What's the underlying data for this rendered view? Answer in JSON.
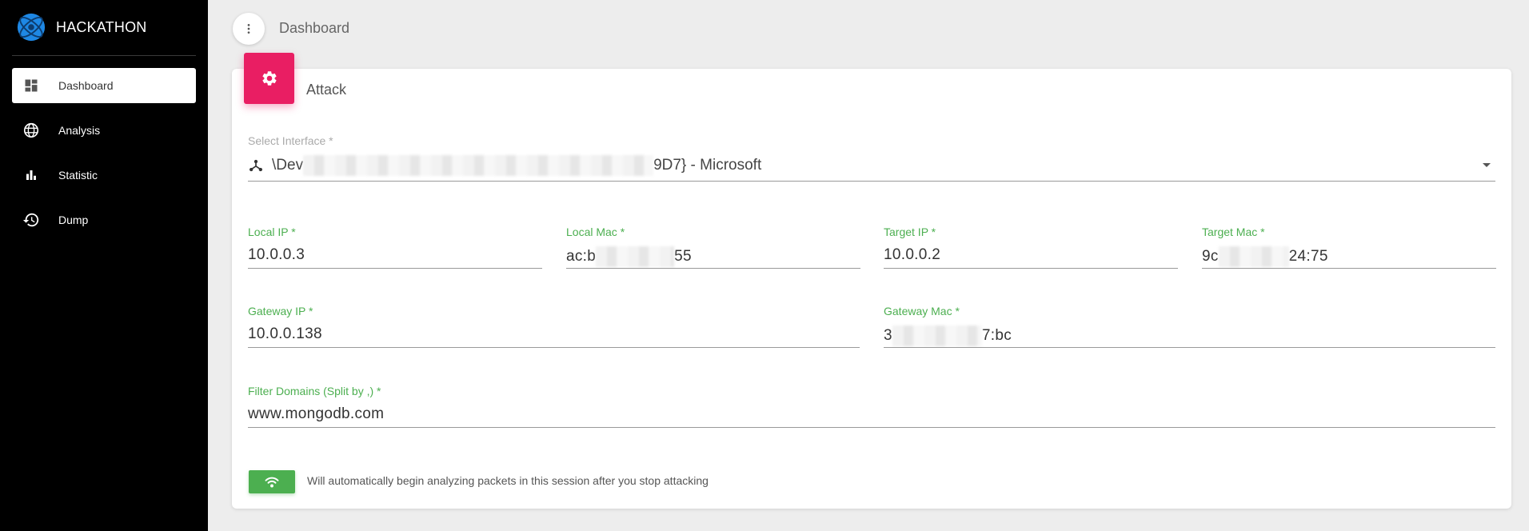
{
  "brand": {
    "name": "HACKATHON",
    "logo_icon": "globe-logo-icon"
  },
  "sidebar": {
    "items": [
      {
        "label": "Dashboard",
        "icon": "dashboard-icon",
        "active": true
      },
      {
        "label": "Analysis",
        "icon": "language-globe-icon",
        "active": false
      },
      {
        "label": "Statistic",
        "icon": "bar-chart-icon",
        "active": false
      },
      {
        "label": "Dump",
        "icon": "history-icon",
        "active": false
      }
    ]
  },
  "header": {
    "title": "Dashboard",
    "menu_icon": "more-vertical-icon"
  },
  "card": {
    "title": "Attack",
    "icon": "gear-icon",
    "accent_color": "#e91e63"
  },
  "form": {
    "interface": {
      "label": "Select Interface *",
      "value_prefix": "\\Dev",
      "value_suffix": "9D7} - Microsoft",
      "icon": "network-share-icon"
    },
    "local_ip": {
      "label": "Local IP *",
      "value": "10.0.0.3"
    },
    "local_mac": {
      "label": "Local Mac *",
      "value_prefix": "ac:b",
      "value_suffix": "55"
    },
    "target_ip": {
      "label": "Target IP *",
      "value": "10.0.0.2"
    },
    "target_mac": {
      "label": "Target Mac *",
      "value_prefix": "9c",
      "value_suffix": "24:75"
    },
    "gateway_ip": {
      "label": "Gateway IP *",
      "value": "10.0.0.138"
    },
    "gateway_mac": {
      "label": "Gateway Mac *",
      "value_prefix": "3",
      "value_suffix": "7:bc"
    },
    "filter_domains": {
      "label": "Filter Domains (Split by ,) *",
      "value": "www.mongodb.com"
    }
  },
  "footer": {
    "wifi_icon": "wifi-icon",
    "info": "Will automatically begin analyzing packets in this session after you stop attacking",
    "button_color": "#4caf50"
  }
}
